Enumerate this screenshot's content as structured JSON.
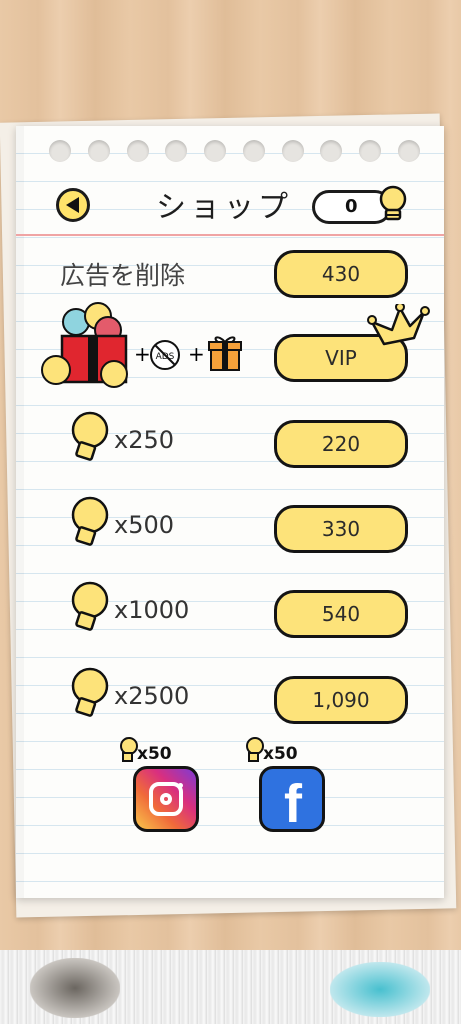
{
  "header": {
    "title": "ショップ",
    "coins": "0"
  },
  "remove_ads": {
    "label": "広告を削除",
    "price": "430"
  },
  "vip": {
    "price": "VIP",
    "ads_text": "ADS"
  },
  "packs": [
    {
      "qty": "x250",
      "price": "220"
    },
    {
      "qty": "x500",
      "price": "330"
    },
    {
      "qty": "x1000",
      "price": "540"
    },
    {
      "qty": "x2500",
      "price": "1,090"
    }
  ],
  "social": {
    "instagram_reward": "x50",
    "facebook_reward": "x50",
    "facebook_letter": "f"
  },
  "colors": {
    "button": "#fde37a",
    "accent_line": "#f0a4a4",
    "instagram": "#d92f7f",
    "facebook": "#2f72e0"
  }
}
